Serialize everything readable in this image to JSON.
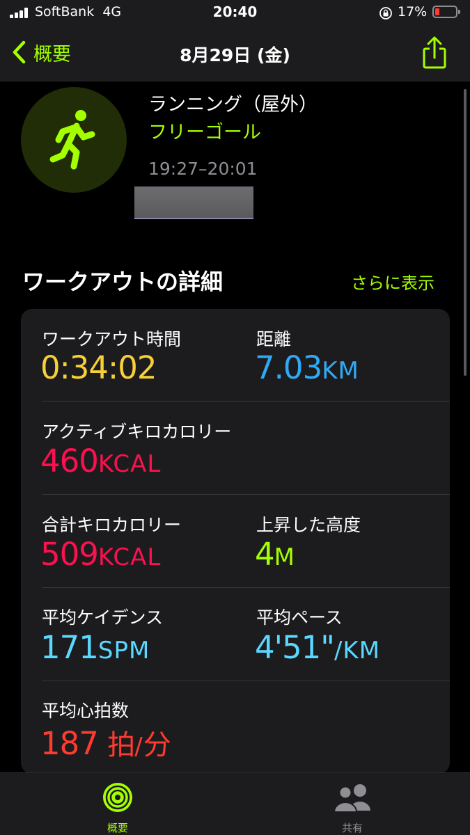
{
  "status_bar": {
    "carrier": "SoftBank",
    "network": "4G",
    "time": "20:40",
    "battery": "17%"
  },
  "nav": {
    "back_label": "概要",
    "title": "8月29日 (金)"
  },
  "workout": {
    "type": "ランニング（屋外）",
    "goal": "フリーゴール",
    "time_range": "19:27–20:01"
  },
  "details": {
    "title": "ワークアウトの詳細",
    "show_more": "さらに表示",
    "metrics": {
      "duration": {
        "label": "ワークアウト時間",
        "value": "0:34:02",
        "unit": "",
        "color": "#f7d038"
      },
      "distance": {
        "label": "距離",
        "value": "7.03",
        "unit": "KM",
        "color": "#30aaf7"
      },
      "active_kcal": {
        "label": "アクティブキロカロリー",
        "value": "460",
        "unit": "KCAL",
        "color": "#fa114f"
      },
      "total_kcal": {
        "label": "合計キロカロリー",
        "value": "509",
        "unit": "KCAL",
        "color": "#fa114f"
      },
      "elevation": {
        "label": "上昇した高度",
        "value": "4",
        "unit": "M",
        "color": "#a4ff00"
      },
      "cadence": {
        "label": "平均ケイデンス",
        "value": "171",
        "unit": "SPM",
        "color": "#5ad8ff"
      },
      "pace": {
        "label": "平均ペース",
        "value": "4'51\"",
        "unit": "/KM",
        "color": "#5ad8ff"
      },
      "heart_rate": {
        "label": "平均心拍数",
        "value": "187",
        "unit_a": "拍",
        "unit_sep": "/",
        "unit_b": "分",
        "color": "#ff3b30"
      }
    }
  },
  "tabs": [
    {
      "label": "概要",
      "icon": "activity-rings-icon",
      "active": true
    },
    {
      "label": "共有",
      "icon": "people-icon",
      "active": false
    }
  ],
  "colors": {
    "accent": "#a4ff00",
    "background": "#000000",
    "card": "#1c1c1e"
  }
}
